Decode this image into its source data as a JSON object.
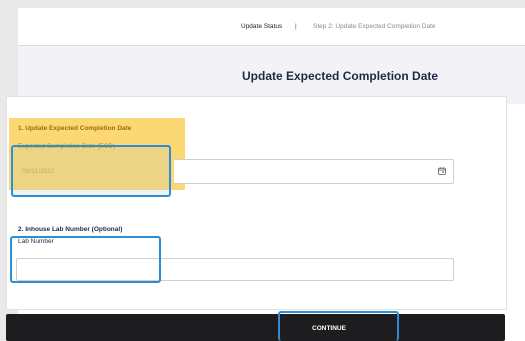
{
  "breadcrumb": {
    "current": "Update Status",
    "separator": "|",
    "step": "Step 2: Update Expected Completion Date"
  },
  "page": {
    "title": "Update Expected Completion Date"
  },
  "section1": {
    "heading": "1. Update Expected Completion Date",
    "field_label": "Expected Completion Date (ECD)",
    "field_value": "08/31/2022",
    "icon": "calendar-icon"
  },
  "section2": {
    "heading": "2. Inhouse Lab Number (Optional)",
    "field_label": "Lab Number",
    "field_value": ""
  },
  "actions": {
    "continue_label": "CONTINUE"
  },
  "colors": {
    "highlight": "#fbd874",
    "focus_outline": "#2c8fd6",
    "button_bg": "#1d1d1f",
    "title_text": "#1f2a44"
  }
}
